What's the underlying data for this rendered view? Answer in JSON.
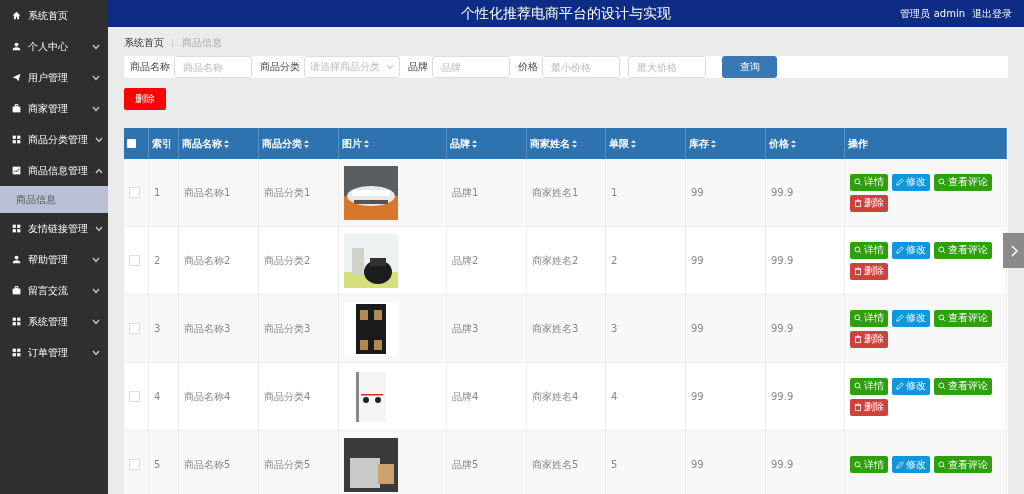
{
  "sidebar": {
    "items": [
      {
        "label": "系统首页"
      },
      {
        "label": "个人中心",
        "expanded": false
      },
      {
        "label": "用户管理",
        "expanded": false
      },
      {
        "label": "商家管理",
        "expanded": false
      },
      {
        "label": "商品分类管理",
        "expanded": false
      },
      {
        "label": "商品信息管理",
        "expanded": true,
        "children": [
          {
            "label": "商品信息",
            "selected": true
          }
        ]
      },
      {
        "label": "友情链接管理",
        "expanded": false
      },
      {
        "label": "帮助管理",
        "expanded": false
      },
      {
        "label": "留言交流",
        "expanded": false
      },
      {
        "label": "系统管理",
        "expanded": false
      },
      {
        "label": "订单管理",
        "expanded": false
      }
    ]
  },
  "header": {
    "title": "个性化推荐电商平台的设计与实现",
    "user": "管理员 admin",
    "logout": "退出登录"
  },
  "breadcrumb": [
    "系统首页",
    "商品信息"
  ],
  "search": {
    "fields": [
      {
        "label": "商品名称",
        "kind": "text",
        "placeholder": "商品名称"
      },
      {
        "label": "商品分类",
        "kind": "select",
        "placeholder": "请选择商品分类"
      },
      {
        "label": "品牌",
        "kind": "text",
        "placeholder": "品牌"
      },
      {
        "label": "价格",
        "kind": "text",
        "placeholder": "最小价格"
      },
      {
        "kind": "text",
        "placeholder": "最大价格"
      }
    ],
    "button": "查询"
  },
  "delete_button": "删除",
  "table": {
    "all_checked": false,
    "columns": [
      {
        "label": "索引",
        "sortable": false
      },
      {
        "label": "商品名称",
        "sortable": true
      },
      {
        "label": "商品分类",
        "sortable": true
      },
      {
        "label": "图片",
        "sortable": true
      },
      {
        "label": "品牌",
        "sortable": true
      },
      {
        "label": "商家姓名",
        "sortable": true
      },
      {
        "label": "单限",
        "sortable": true
      },
      {
        "label": "库存",
        "sortable": true
      },
      {
        "label": "价格",
        "sortable": true
      },
      {
        "label": "操作",
        "sortable": false
      }
    ],
    "rows": [
      {
        "checked": false,
        "cells": [
          "1",
          "商品名称1",
          "商品分类1",
          {
            "kind": "picture"
          },
          "品牌1",
          "商家姓名1",
          "1",
          "99",
          "99.9"
        ],
        "actions": [
          {
            "kind": "detail",
            "label": "详情"
          },
          {
            "kind": "edit",
            "label": "修改"
          },
          {
            "kind": "comments",
            "label": "查看评论"
          },
          {
            "kind": "delete",
            "label": "删除"
          }
        ]
      },
      {
        "checked": false,
        "cells": [
          "2",
          "商品名称2",
          "商品分类2",
          {
            "kind": "picture"
          },
          "品牌2",
          "商家姓名2",
          "2",
          "99",
          "99.9"
        ],
        "actions": [
          {
            "kind": "detail",
            "label": "详情"
          },
          {
            "kind": "edit",
            "label": "修改"
          },
          {
            "kind": "comments",
            "label": "查看评论"
          },
          {
            "kind": "delete",
            "label": "删除"
          }
        ]
      },
      {
        "checked": false,
        "cells": [
          "3",
          "商品名称3",
          "商品分类3",
          {
            "kind": "picture"
          },
          "品牌3",
          "商家姓名3",
          "3",
          "99",
          "99.9"
        ],
        "actions": [
          {
            "kind": "detail",
            "label": "详情"
          },
          {
            "kind": "edit",
            "label": "修改"
          },
          {
            "kind": "comments",
            "label": "查看评论"
          },
          {
            "kind": "delete",
            "label": "删除"
          }
        ]
      },
      {
        "checked": false,
        "cells": [
          "4",
          "商品名称4",
          "商品分类4",
          {
            "kind": "picture"
          },
          "品牌4",
          "商家姓名4",
          "4",
          "99",
          "99.9"
        ],
        "actions": [
          {
            "kind": "detail",
            "label": "详情"
          },
          {
            "kind": "edit",
            "label": "修改"
          },
          {
            "kind": "comments",
            "label": "查看评论"
          },
          {
            "kind": "delete",
            "label": "删除"
          }
        ]
      },
      {
        "checked": false,
        "cells": [
          "5",
          "商品名称5",
          "商品分类5",
          {
            "kind": "picture"
          },
          "品牌5",
          "商家姓名5",
          "5",
          "99",
          "99.9"
        ],
        "actions": [
          {
            "kind": "detail",
            "label": "详情"
          },
          {
            "kind": "edit",
            "label": "修改"
          },
          {
            "kind": "comments",
            "label": "查看评论"
          }
        ]
      }
    ]
  }
}
